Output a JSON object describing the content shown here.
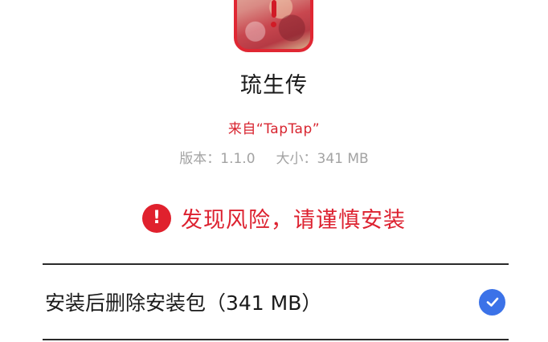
{
  "app": {
    "name": "琉生传",
    "source": "来自“TapTap”",
    "version_text": "版本：1.1.0",
    "size_text": "大小：341 MB"
  },
  "risk": {
    "icon": "exclamation-icon",
    "text": "发现风险，请谨慎安装"
  },
  "option": {
    "label": "安装后删除安装包（341 MB）",
    "checked": true,
    "icon": "checkmark-icon"
  },
  "colors": {
    "warning_red": "#e0212d",
    "check_blue": "#3b72e8",
    "meta_gray": "#a3a3a3"
  }
}
